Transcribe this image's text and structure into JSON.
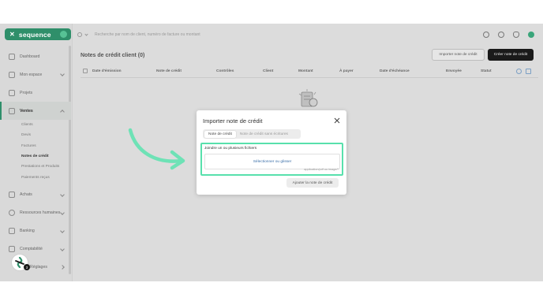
{
  "app": {
    "brand": "sequence"
  },
  "search": {
    "placeholder": "Recherche par nom de client, numéro de facture ou montant"
  },
  "sidebar": {
    "items": [
      {
        "label": "Dashboard"
      },
      {
        "label": "Mon espace"
      },
      {
        "label": "Projets"
      },
      {
        "label": "Ventes"
      },
      {
        "label": "Achats"
      },
      {
        "label": "Ressources humaines"
      },
      {
        "label": "Banking"
      },
      {
        "label": "Comptabilité"
      },
      {
        "label": "Réglages"
      }
    ],
    "sub_items": [
      {
        "label": "Clients"
      },
      {
        "label": "Devis"
      },
      {
        "label": "Factures"
      },
      {
        "label": "Notes de crédit"
      },
      {
        "label": "Prestations et Produits"
      },
      {
        "label": "Paiements reçus"
      }
    ]
  },
  "main": {
    "title": "Notes de crédit client (0)",
    "import_button": "Importer note de crédit",
    "create_button": "Créer note de crédit",
    "columns": [
      "Date d'émission",
      "Note de crédit",
      "Contrôles",
      "Client",
      "Montant",
      "À payer",
      "Date d'échéance",
      "Envoyée",
      "Statut"
    ]
  },
  "modal": {
    "title": "Importer note de crédit",
    "tabs": [
      {
        "label": "Note de crédit",
        "active": true
      },
      {
        "label": "Note de crédit sans écritures",
        "active": false
      }
    ],
    "drop_label": "Joindre un ou plusieurs fichiers",
    "drop_action": "Sélectionner ou glisser",
    "drop_hint": "application/pdf ou image/*",
    "submit": "Ajouter la note de crédit"
  },
  "help": {
    "count": "3"
  },
  "colors": {
    "brand": "#2f8f6a",
    "highlight": "#58e0ac",
    "arrow": "#6ee2b6",
    "link": "#3b6fa8"
  }
}
